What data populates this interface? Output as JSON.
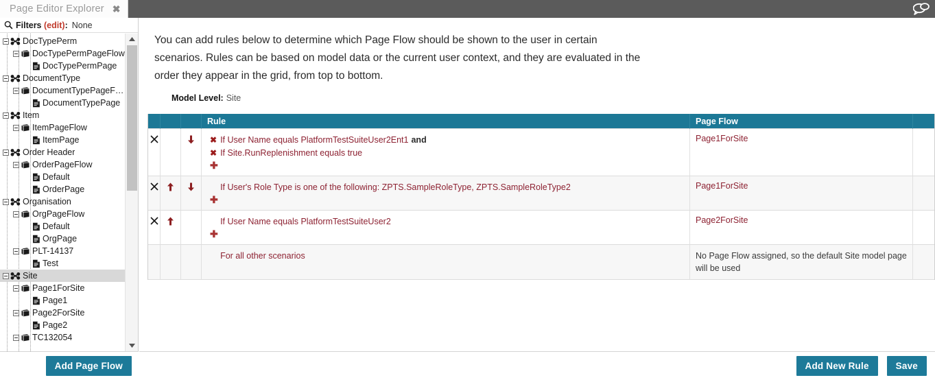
{
  "window": {
    "tab_label": "Page Editor Explorer",
    "close_icon": "close-icon",
    "chat_icon": "chat-bubble-icon"
  },
  "sidebar": {
    "filters": {
      "search_icon": "search-icon",
      "label": "Filters",
      "edit_label": "(edit)",
      "colon": ":",
      "value": "None"
    },
    "tree": [
      {
        "label": "DocTypePerm",
        "level": 0,
        "icon": "model-icon",
        "expanded": true,
        "selected": false
      },
      {
        "label": "DocTypePermPageFlow",
        "level": 1,
        "icon": "pageflow-icon",
        "expanded": true,
        "selected": false
      },
      {
        "label": "DocTypePermPage",
        "level": 2,
        "icon": "page-icon",
        "expanded": false,
        "selected": false
      },
      {
        "label": "DocumentType",
        "level": 0,
        "icon": "model-icon",
        "expanded": true,
        "selected": false
      },
      {
        "label": "DocumentTypePageFlow",
        "level": 1,
        "icon": "pageflow-icon",
        "expanded": true,
        "selected": false
      },
      {
        "label": "DocumentTypePage",
        "level": 2,
        "icon": "page-icon",
        "expanded": false,
        "selected": false
      },
      {
        "label": "Item",
        "level": 0,
        "icon": "model-icon",
        "expanded": true,
        "selected": false
      },
      {
        "label": "ItemPageFlow",
        "level": 1,
        "icon": "pageflow-icon",
        "expanded": true,
        "selected": false
      },
      {
        "label": "ItemPage",
        "level": 2,
        "icon": "page-icon",
        "expanded": false,
        "selected": false
      },
      {
        "label": "Order Header",
        "level": 0,
        "icon": "model-icon",
        "expanded": true,
        "selected": false
      },
      {
        "label": "OrderPageFlow",
        "level": 1,
        "icon": "pageflow-icon",
        "expanded": true,
        "selected": false
      },
      {
        "label": "Default",
        "level": 2,
        "icon": "page-icon",
        "expanded": false,
        "selected": false
      },
      {
        "label": "OrderPage",
        "level": 2,
        "icon": "page-icon",
        "expanded": false,
        "selected": false
      },
      {
        "label": "Organisation",
        "level": 0,
        "icon": "model-icon",
        "expanded": true,
        "selected": false
      },
      {
        "label": "OrgPageFlow",
        "level": 1,
        "icon": "pageflow-icon",
        "expanded": true,
        "selected": false
      },
      {
        "label": "Default",
        "level": 2,
        "icon": "page-icon",
        "expanded": false,
        "selected": false
      },
      {
        "label": "OrgPage",
        "level": 2,
        "icon": "page-icon",
        "expanded": false,
        "selected": false
      },
      {
        "label": "PLT-14137",
        "level": 1,
        "icon": "pageflow-icon",
        "expanded": true,
        "selected": false
      },
      {
        "label": "Test",
        "level": 2,
        "icon": "page-icon",
        "expanded": false,
        "selected": false
      },
      {
        "label": "Site",
        "level": 0,
        "icon": "model-icon",
        "expanded": true,
        "selected": true
      },
      {
        "label": "Page1ForSite",
        "level": 1,
        "icon": "pageflow-icon",
        "expanded": true,
        "selected": false
      },
      {
        "label": "Page1",
        "level": 2,
        "icon": "page-icon",
        "expanded": false,
        "selected": false
      },
      {
        "label": "Page2ForSite",
        "level": 1,
        "icon": "pageflow-icon",
        "expanded": true,
        "selected": false
      },
      {
        "label": "Page2",
        "level": 2,
        "icon": "page-icon",
        "expanded": false,
        "selected": false
      },
      {
        "label": "TC132054",
        "level": 1,
        "icon": "pageflow-icon",
        "expanded": true,
        "selected": false
      }
    ],
    "scroll": {
      "up_icon": "scroll-up-arrow-icon",
      "down_icon": "scroll-down-arrow-icon"
    },
    "add_page_flow_label": "Add Page Flow"
  },
  "main": {
    "intro": "You can add rules below to determine which Page Flow should be shown to the user in certain scenarios. Rules can be based on model data or the current user context, and they are evaluated in the order they appear in the grid, from top to bottom.",
    "model_level_label": "Model Level:",
    "model_level_value": "Site",
    "grid": {
      "columns": [
        "",
        "",
        "",
        "Rule",
        "Page Flow",
        ""
      ],
      "rows": [
        {
          "delete_icon": "delete-row-icon",
          "move_up_icon": "",
          "move_down_icon": "move-down-arrow-icon",
          "conditions": [
            {
              "remove_icon": "remove-condition-icon",
              "text": "If User Name equals PlatformTestSuiteUser2Ent1",
              "suffix": "and"
            },
            {
              "remove_icon": "remove-condition-icon",
              "text": "If Site.RunReplenishment equals true",
              "suffix": ""
            }
          ],
          "add_condition_icon": "add-condition-icon",
          "page_flow": "Page1ForSite",
          "page_flow_is_link": true
        },
        {
          "delete_icon": "delete-row-icon",
          "move_up_icon": "move-up-arrow-icon",
          "move_down_icon": "move-down-arrow-icon",
          "conditions": [
            {
              "remove_icon": "",
              "text": "If User's Role Type is one of the following: ZPTS.SampleRoleType, ZPTS.SampleRoleType2",
              "suffix": ""
            }
          ],
          "add_condition_icon": "add-condition-icon",
          "page_flow": "Page1ForSite",
          "page_flow_is_link": true
        },
        {
          "delete_icon": "delete-row-icon",
          "move_up_icon": "move-up-arrow-icon",
          "move_down_icon": "",
          "conditions": [
            {
              "remove_icon": "",
              "text": "If User Name equals PlatformTestSuiteUser2",
              "suffix": ""
            }
          ],
          "add_condition_icon": "add-condition-icon",
          "page_flow": "Page2ForSite",
          "page_flow_is_link": true
        },
        {
          "delete_icon": "",
          "move_up_icon": "",
          "move_down_icon": "",
          "conditions": [
            {
              "remove_icon": "",
              "text": "For all other scenarios",
              "suffix": ""
            }
          ],
          "add_condition_icon": "",
          "page_flow": "No Page Flow assigned, so the default Site model page will be used",
          "page_flow_is_link": false
        }
      ]
    },
    "add_new_rule_label": "Add New Rule",
    "save_label": "Save"
  },
  "colors": {
    "accent_teal": "#1c7896",
    "button_teal": "#1d7a99",
    "rule_red": "#8d2232",
    "topbar_gray": "#5b5b5b",
    "selected_row": "#d8d8d8"
  }
}
